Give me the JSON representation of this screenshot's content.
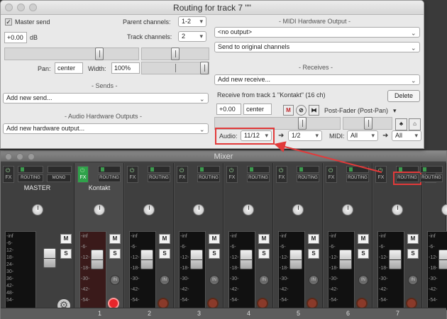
{
  "routing": {
    "title": "Routing for track 7 \"\"",
    "master_send_label": "Master send",
    "parent_channels_label": "Parent channels:",
    "parent_channels_value": "1-2",
    "track_channels_label": "Track channels:",
    "track_channels_value": "2",
    "volume_value": "+0.00",
    "volume_unit": "dB",
    "pan_label": "Pan:",
    "pan_value": "center",
    "width_label": "Width:",
    "width_value": "100%",
    "sends_header": "- Sends -",
    "add_send": "Add new send...",
    "hw_outputs_header": "- Audio Hardware Outputs -",
    "add_hw_output": "Add new hardware output...",
    "midi_hw_header": "- MIDI Hardware Output -",
    "midi_output": "<no output>",
    "midi_send_mode": "Send to original channels",
    "receives_header": "- Receives -",
    "add_receive": "Add new receive...",
    "receive_from": "Receive from track 1 \"Kontakt\" (16 ch)",
    "delete_label": "Delete",
    "recv_volume": "+0.00",
    "recv_pan": "center",
    "mute_label": "M",
    "post_fader": "Post-Fader (Post-Pan)",
    "audio_label": "Audio:",
    "audio_src": "11/12",
    "audio_dst": "1/2",
    "midi_label": "MIDI:",
    "midi_src": "All",
    "midi_dst": "All"
  },
  "mixer": {
    "title": "Mixer",
    "fx_label": "FX",
    "routing_label": "ROUTING",
    "mono_label": "MONO",
    "master_name": "MASTER",
    "kontakt_name": "Kontakt",
    "mute": "M",
    "solo": "S",
    "in_label": "IN",
    "scale": [
      "-inf",
      "-6-",
      "12-",
      "18-",
      "24-",
      "30-",
      "36-",
      "42-",
      "48-",
      "54-"
    ],
    "scale_right": [
      "-inf",
      "-6-",
      "-12-",
      "-18-",
      "-30-",
      "-42-",
      "-54-"
    ],
    "track_numbers": [
      "1",
      "2",
      "3",
      "4",
      "5",
      "6",
      "7"
    ]
  },
  "colors": {
    "highlight": "#e23a3a",
    "fx_on": "#2fa24a",
    "rec_on": "#e8252b"
  }
}
